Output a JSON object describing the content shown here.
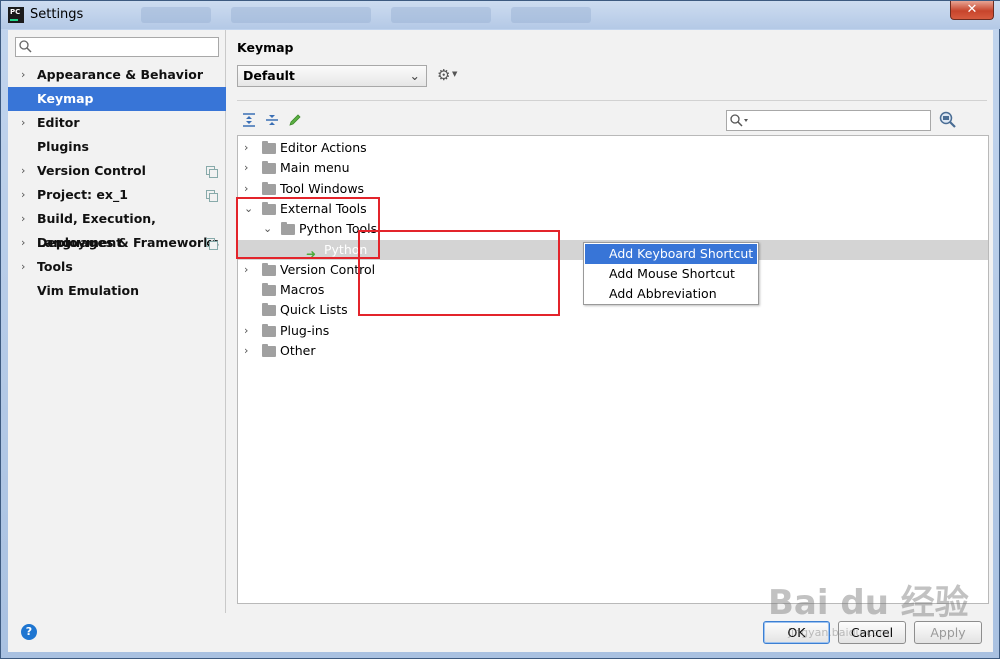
{
  "window": {
    "title": "Settings",
    "close_label": "✕",
    "app_icon_text": "PC"
  },
  "sidebar": {
    "search_placeholder": "",
    "items": [
      {
        "label": "Appearance & Behavior",
        "expandable": true,
        "selected": false,
        "project_icon": false
      },
      {
        "label": "Keymap",
        "expandable": false,
        "selected": true,
        "project_icon": false
      },
      {
        "label": "Editor",
        "expandable": true,
        "selected": false,
        "project_icon": false
      },
      {
        "label": "Plugins",
        "expandable": false,
        "selected": false,
        "project_icon": false
      },
      {
        "label": "Version Control",
        "expandable": true,
        "selected": false,
        "project_icon": true
      },
      {
        "label": "Project: ex_1",
        "expandable": true,
        "selected": false,
        "project_icon": true
      },
      {
        "label": "Build, Execution, Deployment",
        "expandable": true,
        "selected": false,
        "project_icon": false
      },
      {
        "label": "Languages & Frameworks",
        "expandable": true,
        "selected": false,
        "project_icon": true
      },
      {
        "label": "Tools",
        "expandable": true,
        "selected": false,
        "project_icon": false
      },
      {
        "label": "Vim Emulation",
        "expandable": false,
        "selected": false,
        "project_icon": false
      }
    ]
  },
  "main": {
    "title": "Keymap",
    "scheme_value": "Default",
    "tree": [
      {
        "label": "Editor Actions",
        "arrow": "›",
        "level": 0
      },
      {
        "label": "Main menu",
        "arrow": "›",
        "level": 0
      },
      {
        "label": "Tool Windows",
        "arrow": "›",
        "level": 0
      },
      {
        "label": "External Tools",
        "arrow": "⌄",
        "level": 0
      },
      {
        "label": "Python Tools",
        "arrow": "⌄",
        "level": 1
      },
      {
        "label": "Python",
        "arrow": "",
        "level": 2
      },
      {
        "label": "Version Control",
        "arrow": "›",
        "level": 0
      },
      {
        "label": "Macros",
        "arrow": "",
        "level": 0
      },
      {
        "label": "Quick Lists",
        "arrow": "",
        "level": 0
      },
      {
        "label": "Plug-ins",
        "arrow": "›",
        "level": 0
      },
      {
        "label": "Other",
        "arrow": "›",
        "level": 0
      }
    ]
  },
  "context_menu": {
    "items": [
      {
        "label": "Add Keyboard Shortcut",
        "active": true
      },
      {
        "label": "Add Mouse Shortcut",
        "active": false
      },
      {
        "label": "Add Abbreviation",
        "active": false
      }
    ]
  },
  "footer": {
    "help_label": "?",
    "ok_label": "OK",
    "cancel_label": "Cancel",
    "apply_label": "Apply"
  },
  "watermark": {
    "brand": "Bai du 经验",
    "url": "jingyan.baidu.com"
  },
  "colors": {
    "selection": "#3875d7",
    "annotation": "#e3242b",
    "tree_selected": "#d4d4d4"
  }
}
